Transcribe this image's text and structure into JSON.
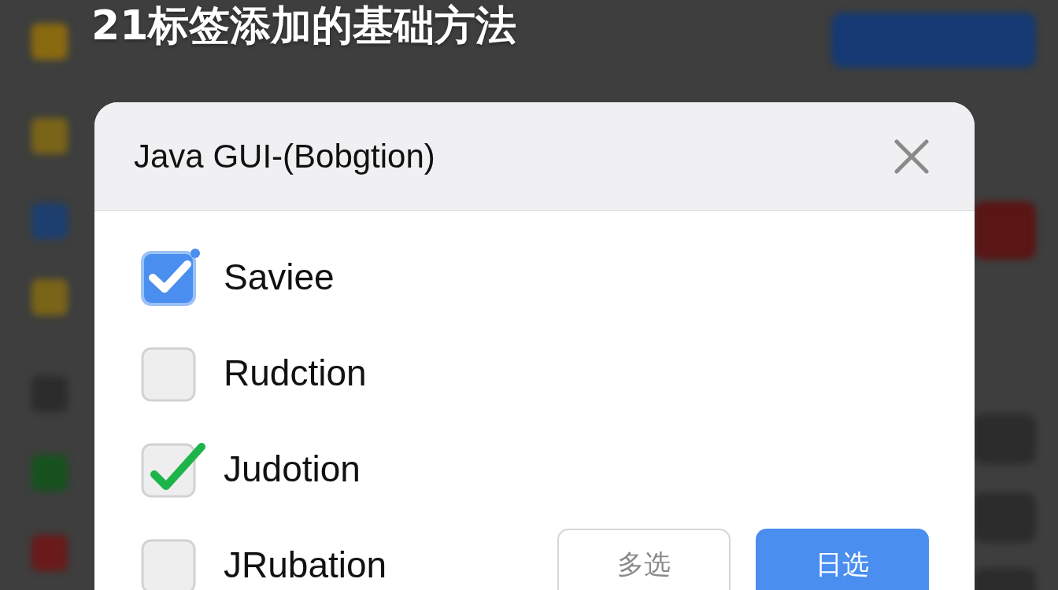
{
  "caption": "21标签添加的基础方法",
  "dialog": {
    "title": "Java GUI-(Bobgtion)",
    "options": [
      {
        "label": "Saviee",
        "checked": true,
        "kind": "filled"
      },
      {
        "label": "Rudction",
        "checked": false
      },
      {
        "label": "Judotion",
        "checked": true,
        "kind": "tick"
      },
      {
        "label": "JRubation",
        "checked": false
      }
    ],
    "buttons": [
      {
        "label": "多选",
        "kind": "secondary"
      },
      {
        "label": "日选",
        "kind": "primary"
      }
    ]
  }
}
